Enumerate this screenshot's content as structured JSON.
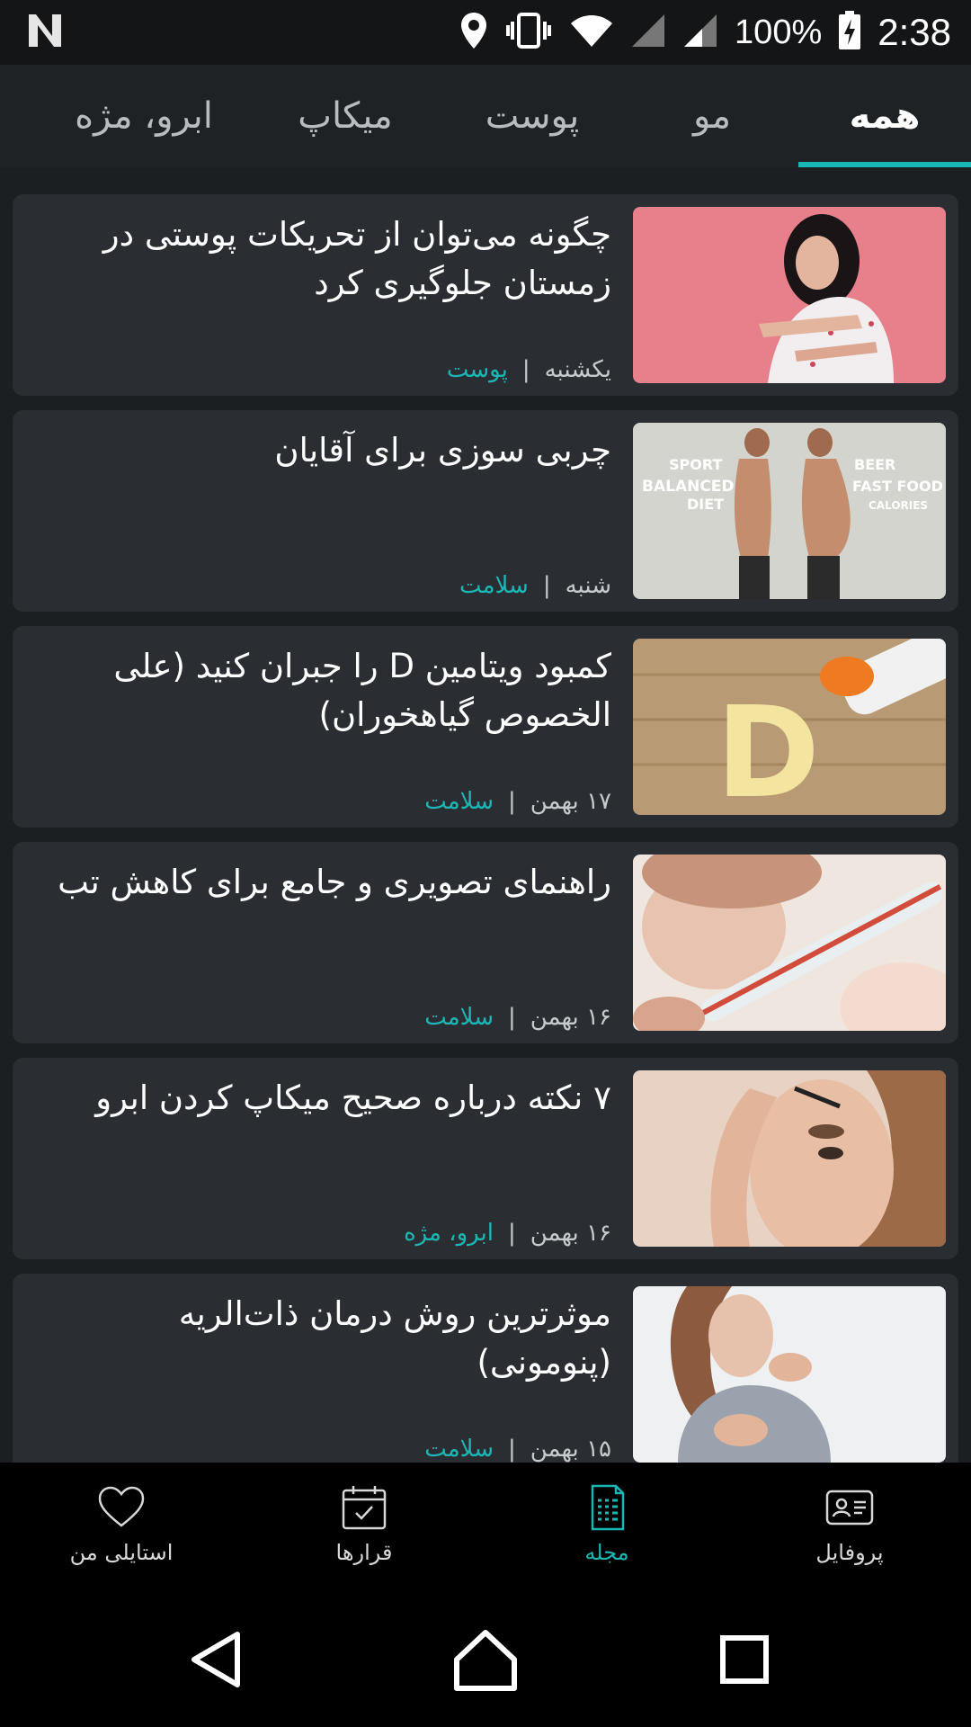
{
  "status_bar": {
    "battery": "100%",
    "time": "2:38",
    "icons": [
      "n-logo-icon",
      "location-icon",
      "vibrate-icon",
      "wifi-icon",
      "signal-icon",
      "signal-icon",
      "battery-charging-icon"
    ]
  },
  "tabs": [
    {
      "label": "همه",
      "active": true
    },
    {
      "label": "مو",
      "active": false
    },
    {
      "label": "پوست",
      "active": false
    },
    {
      "label": "میکاپ",
      "active": false
    },
    {
      "label": "ابرو، مژه",
      "active": false
    }
  ],
  "articles": [
    {
      "title": "چگونه می‌توان از تحریکات پوستی در زمستان جلوگیری کرد",
      "date": "یکشنبه",
      "category": "پوست",
      "image": "woman-scratching-arm"
    },
    {
      "title": "چربی سوزی برای آقایان",
      "date": "شنبه",
      "category": "سلامت",
      "image": "balanced-diet-vs-fast-food"
    },
    {
      "title": "کمبود ویتامین D را جبران کنید (علی الخصوص گیاهخوران)",
      "date": "۱۷ بهمن",
      "category": "سلامت",
      "image": "vitamin-d-pills"
    },
    {
      "title": "راهنمای تصویری و جامع برای کاهش تب",
      "date": "۱۶ بهمن",
      "category": "سلامت",
      "image": "thermometer-child"
    },
    {
      "title": "۷ نکته درباره صحیح میکاپ کردن ابرو",
      "date": "۱۶ بهمن",
      "category": "ابرو، مژه",
      "image": "eyebrow-brush"
    },
    {
      "title": "موثرترین روش درمان ذات‌الریه (پنومونی)",
      "date": "۱۵ بهمن",
      "category": "سلامت",
      "image": "woman-coughing"
    }
  ],
  "separator": "|",
  "image_text": {
    "left_top": "SPORT",
    "left_mid": "BALANCED",
    "left_bot": "DIET",
    "right_top": "BEER",
    "right_mid": "FAST FOOD",
    "right_bot": "CALORIES",
    "vitamin": "D"
  },
  "bottom_nav": [
    {
      "label": "پروفایل",
      "icon": "profile-card-icon",
      "active": false
    },
    {
      "label": "مجله",
      "icon": "magazine-icon",
      "active": true
    },
    {
      "label": "قرارها",
      "icon": "calendar-icon",
      "active": false
    },
    {
      "label": "استایلی من",
      "icon": "heart-icon",
      "active": false
    }
  ],
  "colors": {
    "accent": "#1ab7b4",
    "card": "#2a2e33",
    "background": "#1c1f22"
  }
}
